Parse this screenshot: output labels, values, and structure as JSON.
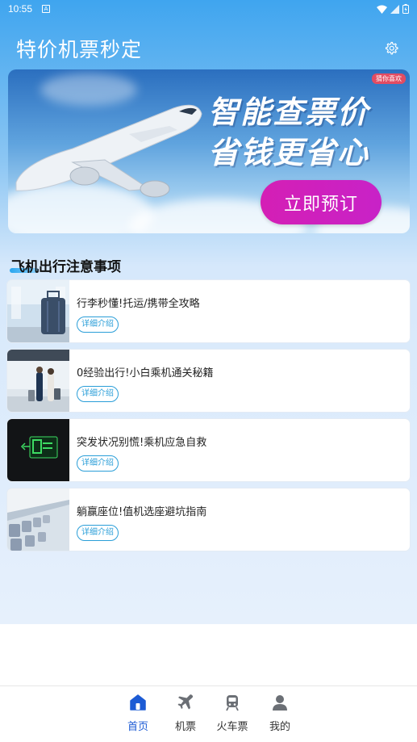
{
  "status_bar": {
    "time": "10:55",
    "notif_glyph": "A"
  },
  "header": {
    "title": "特价机票秒定"
  },
  "banner": {
    "tag": "猜你喜欢",
    "headline_1": "智能查票价",
    "headline_2": "省钱更省心",
    "cta": "立即预订"
  },
  "section": {
    "title": "飞机出行注意事项"
  },
  "articles": [
    {
      "title": "行李秒懂!托运/携带全攻略",
      "link": "详细介绍"
    },
    {
      "title": "0经验出行!小白乘机通关秘籍",
      "link": "详细介绍"
    },
    {
      "title": "突发状况别慌!乘机应急自救",
      "link": "详细介绍"
    },
    {
      "title": "躺赢座位!值机选座避坑指南",
      "link": "详细介绍"
    }
  ],
  "tabs": [
    {
      "label": "首页",
      "icon": "home-icon",
      "active": true
    },
    {
      "label": "机票",
      "icon": "airplane-icon",
      "active": false
    },
    {
      "label": "火车票",
      "icon": "train-icon",
      "active": false
    },
    {
      "label": "我的",
      "icon": "user-icon",
      "active": false
    }
  ],
  "colors": {
    "accent": "#1c5bd4",
    "link": "#2a9ed8",
    "cta": "#d41fb5"
  }
}
